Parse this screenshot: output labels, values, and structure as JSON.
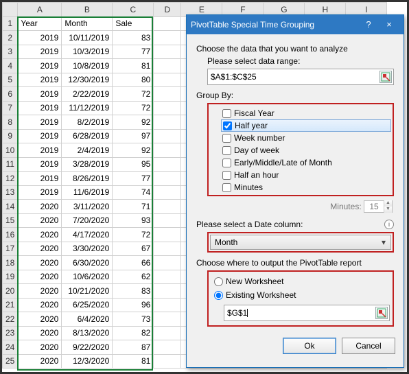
{
  "columns": [
    "A",
    "B",
    "C",
    "D",
    "E",
    "F",
    "G",
    "H",
    "I"
  ],
  "headers": {
    "A": "Year",
    "B": "Month",
    "C": "Sale"
  },
  "rows": [
    {
      "y": "2019",
      "m": "10/11/2019",
      "s": "83"
    },
    {
      "y": "2019",
      "m": "10/3/2019",
      "s": "77"
    },
    {
      "y": "2019",
      "m": "10/8/2019",
      "s": "81"
    },
    {
      "y": "2019",
      "m": "12/30/2019",
      "s": "80"
    },
    {
      "y": "2019",
      "m": "2/22/2019",
      "s": "72"
    },
    {
      "y": "2019",
      "m": "11/12/2019",
      "s": "72"
    },
    {
      "y": "2019",
      "m": "8/2/2019",
      "s": "92"
    },
    {
      "y": "2019",
      "m": "6/28/2019",
      "s": "97"
    },
    {
      "y": "2019",
      "m": "2/4/2019",
      "s": "92"
    },
    {
      "y": "2019",
      "m": "3/28/2019",
      "s": "95"
    },
    {
      "y": "2019",
      "m": "8/26/2019",
      "s": "77"
    },
    {
      "y": "2019",
      "m": "11/6/2019",
      "s": "74"
    },
    {
      "y": "2020",
      "m": "3/11/2020",
      "s": "71"
    },
    {
      "y": "2020",
      "m": "7/20/2020",
      "s": "93"
    },
    {
      "y": "2020",
      "m": "4/17/2020",
      "s": "72"
    },
    {
      "y": "2020",
      "m": "3/30/2020",
      "s": "67"
    },
    {
      "y": "2020",
      "m": "6/30/2020",
      "s": "66"
    },
    {
      "y": "2020",
      "m": "10/6/2020",
      "s": "62"
    },
    {
      "y": "2020",
      "m": "10/21/2020",
      "s": "83"
    },
    {
      "y": "2020",
      "m": "6/25/2020",
      "s": "96"
    },
    {
      "y": "2020",
      "m": "6/4/2020",
      "s": "73"
    },
    {
      "y": "2020",
      "m": "8/13/2020",
      "s": "82"
    },
    {
      "y": "2020",
      "m": "9/22/2020",
      "s": "87"
    },
    {
      "y": "2020",
      "m": "12/3/2020",
      "s": "81"
    }
  ],
  "dialog": {
    "title": "PivotTable Special Time Grouping",
    "help": "?",
    "close": "×",
    "chooseData": "Choose the data that you want to analyze",
    "selectRange": "Please select data range:",
    "rangeValue": "$A$1:$C$25",
    "groupBy": "Group By:",
    "opts": {
      "fiscal": "Fiscal Year",
      "half": "Half year",
      "week": "Week number",
      "dow": "Day of week",
      "eml": "Early/Middle/Late of Month",
      "halfhour": "Half an hour",
      "minutes": "Minutes"
    },
    "minutesLabel": "Minutes:",
    "minutesValue": "15",
    "selectDate": "Please select a Date column:",
    "dateValue": "Month",
    "outputLabel": "Choose where to output the PivotTable report",
    "newWs": "New Worksheet",
    "existWs": "Existing Worksheet",
    "outRange": "$G$1",
    "ok": "Ok",
    "cancel": "Cancel"
  }
}
